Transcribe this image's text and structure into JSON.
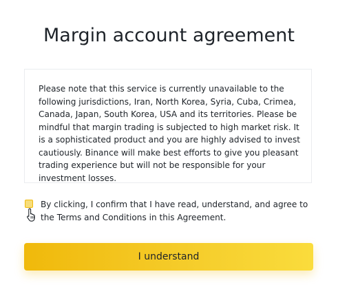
{
  "header": {
    "title": "Margin account agreement"
  },
  "notice": {
    "text": "Please note that this service is currently unavailable to the following jurisdictions, Iran, North Korea, Syria, Cuba, Crimea, Canada, Japan, South Korea, USA and its territories. Please be mindful that margin trading is subjected to high market risk. It is a sophisticated product and you are highly advised to invest cautiously. Binance will make best efforts to give you pleasant trading experience but will not be responsible for your investment losses."
  },
  "agreement": {
    "checkbox_text": "By clicking, I confirm that I have read, understand, and agree to the Terms and Conditions in this Agreement.",
    "checked": false,
    "cursor_icon": "hand-pointer-icon"
  },
  "actions": {
    "understand_label": "I understand"
  },
  "colors": {
    "accent": "#f0b90b",
    "accent_light": "#fadc3c",
    "text": "#1e2329",
    "border": "#eaecef"
  }
}
